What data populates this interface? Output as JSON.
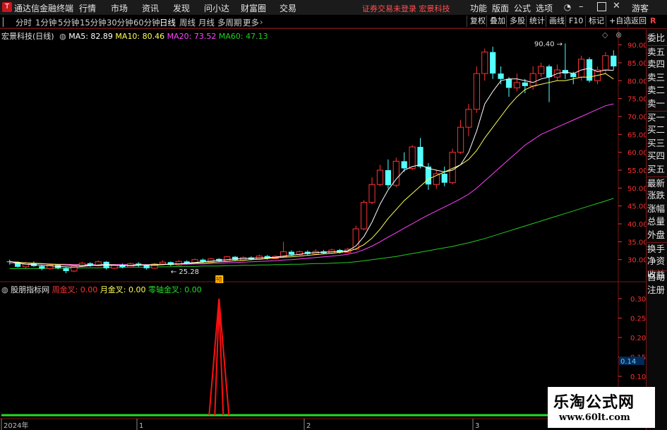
{
  "titlebar": {
    "logo": "T",
    "title": "通达信金融终端",
    "menus": [
      "行情",
      "市场",
      "资讯",
      "发现",
      "问小达",
      "财富圈",
      "交易"
    ],
    "notice": "证券交易未登录  宏景科技",
    "right_menus": [
      "功能",
      "版面",
      "公式",
      "选项"
    ],
    "guest": "游客"
  },
  "toolbar": {
    "periods": [
      "分时",
      "1分钟",
      "5分钟",
      "15分钟",
      "30分钟",
      "60分钟",
      "日线",
      "周线",
      "月线",
      "多周期",
      "更多"
    ],
    "active_period": "日线",
    "right_buttons": [
      "复权",
      "叠加",
      "多股",
      "统计",
      "画线",
      "F10",
      "标记",
      "+自选",
      "返回"
    ]
  },
  "info_line": {
    "stock": "宏景科技(日线)",
    "ma5_label": "MA5: 82.89",
    "ma10_label": "MA10: 80.46",
    "ma20_label": "MA20: 73.52",
    "ma60_label": "MA60: 47.13"
  },
  "indicator_line": {
    "name": "股朋指标网",
    "s1": "周金叉: 0.00",
    "s2": "月金叉: 0.00",
    "s3": "零轴金叉: 0.00"
  },
  "right_panel": [
    "委比",
    "卖五",
    "卖四",
    "卖三",
    "卖二",
    "卖一",
    "买一",
    "买二",
    "买三",
    "买四",
    "买五",
    "最新",
    "涨跌",
    "涨幅",
    "总量",
    "外盘",
    "换手",
    "净资",
    "收益",
    "自动",
    "注册"
  ],
  "corner_label": "R",
  "watermark": {
    "line1": "乐淘公式网",
    "line2": "www.60lt.com"
  },
  "colors": {
    "up": "#ff3232",
    "down": "#54ffff",
    "ma5": "#ffffff",
    "ma10": "#ffff55",
    "ma20": "#ff44ff",
    "ma60": "#22cc22",
    "axis": "#ff3030"
  },
  "chart_data": [
    {
      "type": "candlestick",
      "title": "宏景科技(日线)",
      "y_ticks": [
        90.0,
        85.0,
        80.0,
        75.0,
        70.0,
        65.0,
        60.0,
        55.0,
        50.0,
        45.0,
        40.0,
        35.0,
        30.0
      ],
      "ylim": [
        26.0,
        91.5
      ],
      "max_label": "90.40",
      "min_label": "25.28",
      "buy_marker": "预",
      "x_ticks": [
        "2024年",
        "1",
        "2",
        "3"
      ],
      "candles": [
        [
          29.5,
          29.3,
          30.0,
          28.6
        ],
        [
          29.3,
          28.0,
          29.5,
          27.8
        ],
        [
          28.0,
          29.0,
          29.4,
          27.6
        ],
        [
          29.0,
          28.2,
          29.5,
          28.0
        ],
        [
          28.2,
          27.5,
          28.6,
          27.0
        ],
        [
          27.5,
          28.5,
          28.9,
          27.2
        ],
        [
          28.5,
          27.6,
          28.7,
          27.3
        ],
        [
          27.6,
          26.8,
          27.9,
          26.2
        ],
        [
          26.8,
          28.2,
          28.6,
          26.5
        ],
        [
          28.2,
          29.0,
          29.4,
          27.9
        ],
        [
          29.0,
          28.3,
          29.3,
          28.0
        ],
        [
          28.3,
          29.4,
          29.8,
          28.1
        ],
        [
          29.4,
          27.6,
          29.6,
          27.2
        ],
        [
          27.6,
          28.5,
          28.8,
          27.4
        ],
        [
          28.5,
          27.9,
          28.9,
          27.6
        ],
        [
          27.9,
          28.9,
          29.2,
          27.7
        ],
        [
          28.9,
          28.4,
          29.3,
          28.0
        ],
        [
          28.4,
          27.6,
          28.6,
          27.2
        ],
        [
          27.6,
          28.8,
          29.1,
          27.5
        ],
        [
          28.8,
          29.3,
          29.8,
          28.6
        ],
        [
          29.3,
          28.5,
          29.5,
          28.2
        ],
        [
          28.5,
          29.5,
          29.9,
          28.3
        ],
        [
          29.5,
          29.0,
          29.8,
          28.7
        ],
        [
          29.0,
          30.0,
          30.3,
          28.8
        ],
        [
          30.0,
          29.4,
          30.3,
          29.1
        ],
        [
          29.4,
          30.2,
          30.5,
          29.2
        ],
        [
          30.2,
          29.6,
          30.4,
          29.3
        ],
        [
          29.6,
          30.8,
          31.0,
          29.4
        ],
        [
          30.8,
          29.9,
          31.0,
          29.6
        ],
        [
          29.9,
          30.6,
          30.9,
          29.7
        ],
        [
          30.6,
          30.1,
          30.9,
          29.8
        ],
        [
          30.1,
          31.0,
          31.4,
          29.9
        ],
        [
          31.0,
          30.3,
          31.3,
          30.0
        ],
        [
          30.3,
          30.9,
          31.2,
          30.1
        ],
        [
          30.9,
          32.2,
          35.0,
          30.5
        ],
        [
          32.2,
          31.4,
          32.6,
          31.0
        ],
        [
          31.4,
          32.2,
          32.5,
          31.2
        ],
        [
          32.2,
          31.6,
          32.6,
          31.3
        ],
        [
          31.6,
          32.3,
          32.9,
          31.4
        ],
        [
          32.3,
          31.8,
          32.7,
          31.5
        ],
        [
          31.8,
          32.7,
          33.1,
          31.6
        ],
        [
          32.7,
          32.0,
          33.0,
          31.7
        ],
        [
          32.0,
          32.9,
          33.3,
          31.8
        ],
        [
          32.9,
          38.6,
          39.5,
          32.6
        ],
        [
          38.6,
          46.0,
          46.6,
          38.2
        ],
        [
          46.0,
          51.0,
          53.0,
          45.5
        ],
        [
          51.0,
          55.0,
          56.5,
          50.5
        ],
        [
          55.0,
          50.8,
          58.0,
          49.9
        ],
        [
          50.8,
          57.5,
          58.5,
          50.2
        ],
        [
          57.5,
          55.5,
          60.0,
          54.5
        ],
        [
          55.5,
          61.5,
          62.0,
          55.0
        ],
        [
          61.5,
          56.0,
          64.0,
          55.5
        ],
        [
          56.0,
          51.0,
          57.0,
          49.5
        ],
        [
          51.0,
          54.0,
          55.0,
          49.8
        ],
        [
          54.0,
          51.5,
          56.0,
          50.5
        ],
        [
          51.5,
          60.0,
          61.0,
          51.0
        ],
        [
          60.0,
          67.0,
          69.0,
          59.5
        ],
        [
          67.0,
          72.0,
          73.5,
          64.5
        ],
        [
          72.0,
          82.0,
          84.0,
          71.0
        ],
        [
          82.0,
          88.0,
          89.0,
          80.0
        ],
        [
          88.0,
          82.0,
          89.5,
          80.5
        ],
        [
          82.0,
          80.5,
          84.0,
          79.0
        ],
        [
          80.5,
          78.0,
          81.0,
          75.5
        ],
        [
          78.0,
          79.5,
          82.0,
          77.0
        ],
        [
          79.5,
          78.5,
          80.5,
          76.5
        ],
        [
          78.5,
          82.0,
          84.0,
          77.5
        ],
        [
          82.0,
          84.0,
          85.0,
          81.0
        ],
        [
          84.0,
          81.0,
          84.5,
          74.0
        ],
        [
          81.0,
          83.0,
          84.5,
          80.0
        ],
        [
          83.0,
          82.0,
          90.4,
          80.5
        ],
        [
          82.0,
          81.0,
          82.5,
          79.0
        ],
        [
          81.0,
          86.0,
          87.0,
          80.0
        ],
        [
          86.0,
          80.0,
          86.5,
          79.5
        ],
        [
          80.0,
          83.0,
          84.0,
          79.0
        ],
        [
          83.0,
          87.0,
          88.0,
          82.0
        ],
        [
          87.0,
          84.0,
          88.5,
          83.0
        ]
      ],
      "ma5": [
        29.5,
        29.0,
        28.7,
        28.6,
        28.4,
        28.3,
        28.1,
        28.0,
        27.9,
        28.1,
        28.3,
        28.5,
        28.6,
        28.5,
        28.4,
        28.3,
        28.4,
        28.5,
        28.4,
        28.6,
        28.8,
        28.8,
        29.0,
        29.2,
        29.4,
        29.6,
        29.8,
        30.0,
        30.2,
        30.3,
        30.4,
        30.5,
        30.6,
        30.7,
        31.0,
        31.2,
        31.5,
        31.8,
        32.0,
        32.1,
        32.2,
        32.3,
        32.5,
        33.8,
        36.5,
        40.5,
        45.5,
        49.5,
        52.5,
        55.0,
        56.0,
        56.5,
        55.5,
        55.0,
        54.5,
        55.0,
        56.5,
        60.0,
        66.0,
        73.5,
        77.0,
        80.0,
        80.5,
        80.5,
        80.0,
        79.5,
        80.5,
        81.0,
        82.0,
        82.5,
        82.0,
        83.0,
        83.5,
        82.5,
        83.0,
        82.9
      ],
      "ma10": [
        29.4,
        29.3,
        29.1,
        29.0,
        28.9,
        28.7,
        28.6,
        28.5,
        28.4,
        28.4,
        28.4,
        28.4,
        28.4,
        28.4,
        28.4,
        28.4,
        28.5,
        28.5,
        28.6,
        28.6,
        28.7,
        28.8,
        28.9,
        29.0,
        29.1,
        29.2,
        29.4,
        29.5,
        29.7,
        29.8,
        30.0,
        30.1,
        30.3,
        30.5,
        30.7,
        30.8,
        31.0,
        31.2,
        31.4,
        31.6,
        31.8,
        32.0,
        32.3,
        33.0,
        34.2,
        36.0,
        38.5,
        41.5,
        44.0,
        46.5,
        48.5,
        50.5,
        52.5,
        53.5,
        54.5,
        55.5,
        56.5,
        58.0,
        60.5,
        64.0,
        67.0,
        70.0,
        73.0,
        75.5,
        77.5,
        78.5,
        79.0,
        79.5,
        80.0,
        80.0,
        80.5,
        81.0,
        81.0,
        81.5,
        82.0,
        80.46
      ],
      "ma20": [
        29.0,
        29.0,
        28.9,
        28.9,
        28.8,
        28.8,
        28.7,
        28.7,
        28.6,
        28.6,
        28.6,
        28.6,
        28.6,
        28.6,
        28.6,
        28.6,
        28.6,
        28.6,
        28.6,
        28.6,
        28.7,
        28.7,
        28.7,
        28.8,
        28.8,
        28.9,
        29.0,
        29.1,
        29.2,
        29.3,
        29.4,
        29.5,
        29.6,
        29.7,
        29.9,
        30.0,
        30.2,
        30.4,
        30.6,
        30.8,
        31.0,
        31.2,
        31.5,
        32.0,
        32.8,
        33.8,
        35.0,
        36.3,
        37.5,
        38.8,
        40.0,
        41.3,
        42.5,
        43.6,
        44.7,
        45.8,
        47.0,
        48.3,
        50.0,
        52.0,
        54.0,
        56.0,
        58.0,
        60.0,
        62.0,
        63.5,
        65.0,
        66.0,
        67.0,
        68.0,
        69.0,
        70.0,
        71.0,
        72.0,
        73.0,
        73.52
      ],
      "ma60": [
        27.5,
        27.5,
        27.5,
        27.5,
        27.5,
        27.6,
        27.6,
        27.6,
        27.6,
        27.7,
        27.7,
        27.7,
        27.8,
        27.8,
        27.8,
        27.9,
        27.9,
        27.9,
        28.0,
        28.0,
        28.0,
        28.1,
        28.1,
        28.1,
        28.2,
        28.2,
        28.2,
        28.3,
        28.3,
        28.4,
        28.4,
        28.5,
        28.5,
        28.6,
        28.6,
        28.7,
        28.7,
        28.8,
        28.9,
        28.9,
        29.0,
        29.1,
        29.2,
        29.4,
        29.7,
        30.0,
        30.3,
        30.6,
        30.9,
        31.3,
        31.7,
        32.1,
        32.5,
        32.9,
        33.3,
        33.7,
        34.2,
        34.7,
        35.3,
        35.9,
        36.6,
        37.3,
        38.0,
        38.7,
        39.4,
        40.1,
        40.8,
        41.5,
        42.2,
        42.9,
        43.6,
        44.3,
        45.0,
        45.7,
        46.4,
        47.13
      ]
    },
    {
      "type": "line",
      "title": "股朋指标网",
      "y_ticks": [
        0.3,
        0.25,
        0.2,
        0.15,
        0.1
      ],
      "ylim": [
        0.0,
        0.32
      ],
      "current_value_label": "0.14",
      "spike_index": 26,
      "spike_value": 0.3,
      "baseline_value": 0.0
    }
  ]
}
